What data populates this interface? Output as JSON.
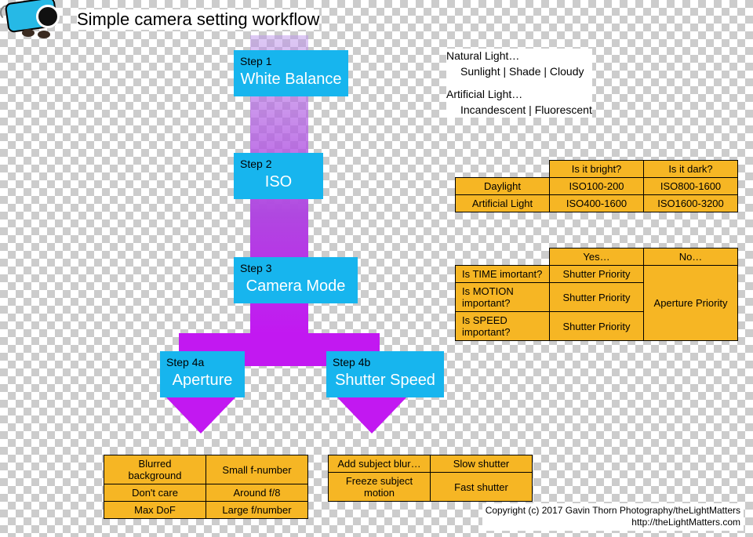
{
  "title": "Simple camera setting workflow",
  "steps": {
    "s1": {
      "label": "Step 1",
      "name": "White Balance"
    },
    "s2": {
      "label": "Step 2",
      "name": "ISO"
    },
    "s3": {
      "label": "Step 3",
      "name": "Camera Mode"
    },
    "s4a": {
      "label": "Step 4a",
      "name": "Aperture"
    },
    "s4b": {
      "label": "Step 4b",
      "name": "Shutter Speed"
    }
  },
  "wb_text": {
    "nat_h": "Natural Light…",
    "nat_v": "Sunlight | Shade | Cloudy",
    "art_h": "Artificial Light…",
    "art_v": "Incandescent | Fluorescent"
  },
  "iso_table": {
    "col1": "Is it bright?",
    "col2": "Is it dark?",
    "rows": [
      {
        "label": "Daylight",
        "bright": "ISO100-200",
        "dark": "ISO800-1600"
      },
      {
        "label": "Artificial Light",
        "bright": "ISO400-1600",
        "dark": "ISO1600-3200"
      }
    ]
  },
  "mode_table": {
    "col1": "Yes…",
    "col2": "No…",
    "rows": [
      {
        "q": "Is TIME imortant?",
        "y": "Shutter Priority"
      },
      {
        "q": "Is MOTION important?",
        "y": "Shutter Priority"
      },
      {
        "q": "Is SPEED important?",
        "y": "Shutter Priority"
      }
    ],
    "no_merged": "Aperture Priority"
  },
  "aperture_table": [
    {
      "l": "Blurred background",
      "r": "Small f-number"
    },
    {
      "l": "Don't care",
      "r": "Around f/8"
    },
    {
      "l": "Max DoF",
      "r": "Large f/number"
    }
  ],
  "shutter_table": [
    {
      "l": "Add subject blur…",
      "r": "Slow shutter"
    },
    {
      "l": "Freeze subject motion",
      "r": "Fast shutter"
    }
  ],
  "footer": {
    "line1": "Copyright (c) 2017 Gavin Thorn Photography/theLightMatters",
    "line2": "http://theLightMatters.com"
  }
}
